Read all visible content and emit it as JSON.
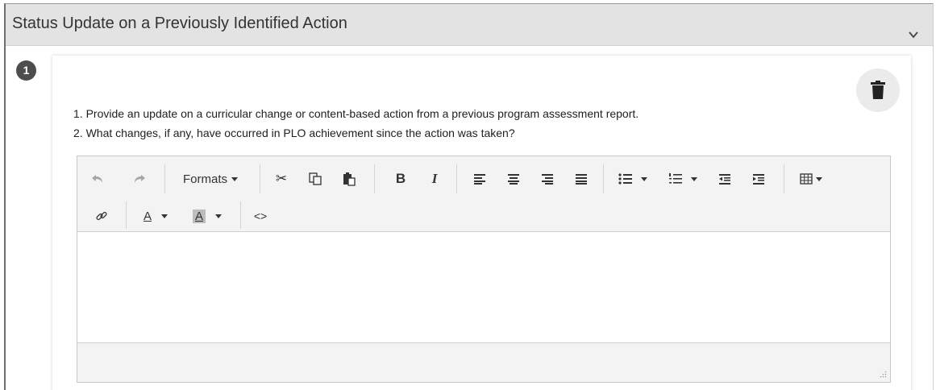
{
  "section": {
    "title": "Status Update on a Previously Identified Action"
  },
  "item": {
    "number": "1",
    "instructions": [
      "1. Provide an update on a curricular change or content-based action from a previous program assessment report.",
      "2. What changes, if any, have occurred in PLO achievement since the action was taken?"
    ]
  },
  "toolbar": {
    "formats_label": "Formats",
    "bold_label": "B",
    "italic_label": "I",
    "font_color_label": "A",
    "bg_color_label": "A",
    "code_label": "<>"
  },
  "icons": [
    "chevron-down-icon",
    "trash-icon",
    "undo-icon",
    "redo-icon",
    "cut-icon",
    "copy-icon",
    "paste-icon",
    "align-left-icon",
    "align-center-icon",
    "align-right-icon",
    "justify-icon",
    "bullet-list-icon",
    "numbered-list-icon",
    "outdent-icon",
    "indent-icon",
    "table-icon",
    "link-icon",
    "resize-grip-icon"
  ],
  "colors": {
    "header_bg": "#e3e3e3",
    "badge_bg": "#4d4d4d",
    "toolbar_bg": "#f3f3f3"
  }
}
